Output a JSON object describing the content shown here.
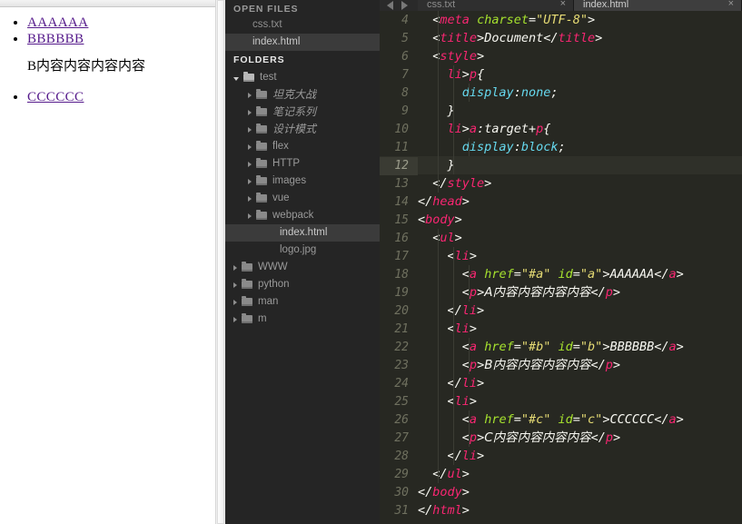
{
  "browser": {
    "links": [
      {
        "label": "AAAAAA",
        "href": "#a"
      },
      {
        "label": "BBBBBB",
        "href": "#b"
      },
      {
        "label": "CCCCCC",
        "href": "#c"
      }
    ],
    "paragraph": "B内容内容内容内容",
    "link_color": "#551a8b"
  },
  "editor": {
    "sidebar": {
      "open_files_label": "OPEN FILES",
      "open_files": [
        {
          "name": "css.txt",
          "selected": false
        },
        {
          "name": "index.html",
          "selected": true
        }
      ],
      "folders_label": "FOLDERS",
      "tree": [
        {
          "name": "test",
          "type": "folder",
          "indent": 0,
          "expanded": true,
          "selected": false
        },
        {
          "name": "坦克大战",
          "type": "folder",
          "indent": 1,
          "expanded": false,
          "selected": false
        },
        {
          "name": "笔记系列",
          "type": "folder",
          "indent": 1,
          "expanded": false,
          "selected": false
        },
        {
          "name": "设计模式",
          "type": "folder",
          "indent": 1,
          "expanded": false,
          "selected": false
        },
        {
          "name": "flex",
          "type": "folder",
          "indent": 1,
          "expanded": false,
          "selected": false
        },
        {
          "name": "HTTP",
          "type": "folder",
          "indent": 1,
          "expanded": false,
          "selected": false
        },
        {
          "name": "images",
          "type": "folder",
          "indent": 1,
          "expanded": false,
          "selected": false
        },
        {
          "name": "vue",
          "type": "folder",
          "indent": 1,
          "expanded": false,
          "selected": false
        },
        {
          "name": "webpack",
          "type": "folder",
          "indent": 1,
          "expanded": false,
          "selected": false
        },
        {
          "name": "index.html",
          "type": "file",
          "indent": 2,
          "expanded": false,
          "selected": true
        },
        {
          "name": "logo.jpg",
          "type": "file",
          "indent": 2,
          "expanded": false,
          "selected": false
        },
        {
          "name": "WWW",
          "type": "folder",
          "indent": 0,
          "expanded": false,
          "selected": false
        },
        {
          "name": "python",
          "type": "folder",
          "indent": 0,
          "expanded": false,
          "selected": false
        },
        {
          "name": "man",
          "type": "folder",
          "indent": 0,
          "expanded": false,
          "selected": false
        },
        {
          "name": "m",
          "type": "folder",
          "indent": 0,
          "expanded": false,
          "selected": false
        }
      ]
    },
    "tabs": [
      {
        "label": "css.txt",
        "active": false,
        "close": "×"
      },
      {
        "label": "index.html",
        "active": true,
        "close": "×"
      }
    ],
    "current_line": 12,
    "first_line": 4,
    "code_lines": [
      {
        "n": 4,
        "guides": 1,
        "tokens": [
          {
            "t": "  ",
            "c": "t-plain"
          },
          {
            "t": "<",
            "c": "t-punct"
          },
          {
            "t": "meta",
            "c": "t-tag"
          },
          {
            "t": " ",
            "c": "t-plain"
          },
          {
            "t": "charset",
            "c": "t-attr"
          },
          {
            "t": "=",
            "c": "t-punct"
          },
          {
            "t": "\"UTF-8\"",
            "c": "t-str"
          },
          {
            "t": ">",
            "c": "t-punct"
          }
        ]
      },
      {
        "n": 5,
        "guides": 1,
        "tokens": [
          {
            "t": "  ",
            "c": "t-plain"
          },
          {
            "t": "<",
            "c": "t-punct"
          },
          {
            "t": "title",
            "c": "t-tag"
          },
          {
            "t": ">",
            "c": "t-punct"
          },
          {
            "t": "Document",
            "c": "t-text"
          },
          {
            "t": "</",
            "c": "t-punct"
          },
          {
            "t": "title",
            "c": "t-tag"
          },
          {
            "t": ">",
            "c": "t-punct"
          }
        ]
      },
      {
        "n": 6,
        "guides": 1,
        "tokens": [
          {
            "t": "  ",
            "c": "t-plain"
          },
          {
            "t": "<",
            "c": "t-punct"
          },
          {
            "t": "style",
            "c": "t-tag"
          },
          {
            "t": ">",
            "c": "t-punct"
          }
        ]
      },
      {
        "n": 7,
        "guides": 2,
        "tokens": [
          {
            "t": "    ",
            "c": "t-plain"
          },
          {
            "t": "li",
            "c": "t-sel"
          },
          {
            "t": ">",
            "c": "t-punct"
          },
          {
            "t": "p",
            "c": "t-sel"
          },
          {
            "t": "{",
            "c": "t-punct"
          }
        ]
      },
      {
        "n": 8,
        "guides": 3,
        "tokens": [
          {
            "t": "      ",
            "c": "t-plain"
          },
          {
            "t": "display",
            "c": "t-prop"
          },
          {
            "t": ":",
            "c": "t-punct"
          },
          {
            "t": "none",
            "c": "t-val"
          },
          {
            "t": ";",
            "c": "t-punct"
          }
        ]
      },
      {
        "n": 9,
        "guides": 2,
        "tokens": [
          {
            "t": "    ",
            "c": "t-plain"
          },
          {
            "t": "}",
            "c": "t-punct"
          }
        ]
      },
      {
        "n": 10,
        "guides": 2,
        "tokens": [
          {
            "t": "    ",
            "c": "t-plain"
          },
          {
            "t": "li",
            "c": "t-sel"
          },
          {
            "t": ">",
            "c": "t-punct"
          },
          {
            "t": "a",
            "c": "t-sel"
          },
          {
            "t": ":",
            "c": "t-punct"
          },
          {
            "t": "target",
            "c": "t-text"
          },
          {
            "t": "+",
            "c": "t-punct"
          },
          {
            "t": "p",
            "c": "t-sel"
          },
          {
            "t": "{",
            "c": "t-punct"
          }
        ]
      },
      {
        "n": 11,
        "guides": 3,
        "tokens": [
          {
            "t": "      ",
            "c": "t-plain"
          },
          {
            "t": "display",
            "c": "t-prop"
          },
          {
            "t": ":",
            "c": "t-punct"
          },
          {
            "t": "block",
            "c": "t-val"
          },
          {
            "t": ";",
            "c": "t-punct"
          }
        ]
      },
      {
        "n": 12,
        "guides": 2,
        "tokens": [
          {
            "t": "    ",
            "c": "t-plain"
          },
          {
            "t": "}",
            "c": "t-punct"
          }
        ]
      },
      {
        "n": 13,
        "guides": 1,
        "tokens": [
          {
            "t": "  ",
            "c": "t-plain"
          },
          {
            "t": "</",
            "c": "t-punct"
          },
          {
            "t": "style",
            "c": "t-tag"
          },
          {
            "t": ">",
            "c": "t-punct"
          }
        ]
      },
      {
        "n": 14,
        "guides": 0,
        "tokens": [
          {
            "t": "</",
            "c": "t-punct"
          },
          {
            "t": "head",
            "c": "t-tag"
          },
          {
            "t": ">",
            "c": "t-punct"
          }
        ]
      },
      {
        "n": 15,
        "guides": 0,
        "tokens": [
          {
            "t": "<",
            "c": "t-punct"
          },
          {
            "t": "body",
            "c": "t-tag"
          },
          {
            "t": ">",
            "c": "t-punct"
          }
        ]
      },
      {
        "n": 16,
        "guides": 1,
        "tokens": [
          {
            "t": "  ",
            "c": "t-plain"
          },
          {
            "t": "<",
            "c": "t-punct"
          },
          {
            "t": "ul",
            "c": "t-tag"
          },
          {
            "t": ">",
            "c": "t-punct"
          }
        ]
      },
      {
        "n": 17,
        "guides": 2,
        "tokens": [
          {
            "t": "    ",
            "c": "t-plain"
          },
          {
            "t": "<",
            "c": "t-punct"
          },
          {
            "t": "li",
            "c": "t-tag"
          },
          {
            "t": ">",
            "c": "t-punct"
          }
        ]
      },
      {
        "n": 18,
        "guides": 3,
        "tokens": [
          {
            "t": "      ",
            "c": "t-plain"
          },
          {
            "t": "<",
            "c": "t-punct"
          },
          {
            "t": "a",
            "c": "t-tag"
          },
          {
            "t": " ",
            "c": "t-plain"
          },
          {
            "t": "href",
            "c": "t-attr"
          },
          {
            "t": "=",
            "c": "t-punct"
          },
          {
            "t": "\"#a\"",
            "c": "t-str"
          },
          {
            "t": " ",
            "c": "t-plain"
          },
          {
            "t": "id",
            "c": "t-attr"
          },
          {
            "t": "=",
            "c": "t-punct"
          },
          {
            "t": "\"a\"",
            "c": "t-str"
          },
          {
            "t": ">",
            "c": "t-punct"
          },
          {
            "t": "AAAAAA",
            "c": "t-text"
          },
          {
            "t": "</",
            "c": "t-punct"
          },
          {
            "t": "a",
            "c": "t-tag"
          },
          {
            "t": ">",
            "c": "t-punct"
          }
        ]
      },
      {
        "n": 19,
        "guides": 3,
        "tokens": [
          {
            "t": "      ",
            "c": "t-plain"
          },
          {
            "t": "<",
            "c": "t-punct"
          },
          {
            "t": "p",
            "c": "t-tag"
          },
          {
            "t": ">",
            "c": "t-punct"
          },
          {
            "t": "A内容内容内容内容",
            "c": "t-text"
          },
          {
            "t": "</",
            "c": "t-punct"
          },
          {
            "t": "p",
            "c": "t-tag"
          },
          {
            "t": ">",
            "c": "t-punct"
          }
        ]
      },
      {
        "n": 20,
        "guides": 2,
        "tokens": [
          {
            "t": "    ",
            "c": "t-plain"
          },
          {
            "t": "</",
            "c": "t-punct"
          },
          {
            "t": "li",
            "c": "t-tag"
          },
          {
            "t": ">",
            "c": "t-punct"
          }
        ]
      },
      {
        "n": 21,
        "guides": 2,
        "tokens": [
          {
            "t": "    ",
            "c": "t-plain"
          },
          {
            "t": "<",
            "c": "t-punct"
          },
          {
            "t": "li",
            "c": "t-tag"
          },
          {
            "t": ">",
            "c": "t-punct"
          }
        ]
      },
      {
        "n": 22,
        "guides": 3,
        "tokens": [
          {
            "t": "      ",
            "c": "t-plain"
          },
          {
            "t": "<",
            "c": "t-punct"
          },
          {
            "t": "a",
            "c": "t-tag"
          },
          {
            "t": " ",
            "c": "t-plain"
          },
          {
            "t": "href",
            "c": "t-attr"
          },
          {
            "t": "=",
            "c": "t-punct"
          },
          {
            "t": "\"#b\"",
            "c": "t-str"
          },
          {
            "t": " ",
            "c": "t-plain"
          },
          {
            "t": "id",
            "c": "t-attr"
          },
          {
            "t": "=",
            "c": "t-punct"
          },
          {
            "t": "\"b\"",
            "c": "t-str"
          },
          {
            "t": ">",
            "c": "t-punct"
          },
          {
            "t": "BBBBBB",
            "c": "t-text"
          },
          {
            "t": "</",
            "c": "t-punct"
          },
          {
            "t": "a",
            "c": "t-tag"
          },
          {
            "t": ">",
            "c": "t-punct"
          }
        ]
      },
      {
        "n": 23,
        "guides": 3,
        "tokens": [
          {
            "t": "      ",
            "c": "t-plain"
          },
          {
            "t": "<",
            "c": "t-punct"
          },
          {
            "t": "p",
            "c": "t-tag"
          },
          {
            "t": ">",
            "c": "t-punct"
          },
          {
            "t": "B内容内容内容内容",
            "c": "t-text"
          },
          {
            "t": "</",
            "c": "t-punct"
          },
          {
            "t": "p",
            "c": "t-tag"
          },
          {
            "t": ">",
            "c": "t-punct"
          }
        ]
      },
      {
        "n": 24,
        "guides": 2,
        "tokens": [
          {
            "t": "    ",
            "c": "t-plain"
          },
          {
            "t": "</",
            "c": "t-punct"
          },
          {
            "t": "li",
            "c": "t-tag"
          },
          {
            "t": ">",
            "c": "t-punct"
          }
        ]
      },
      {
        "n": 25,
        "guides": 2,
        "tokens": [
          {
            "t": "    ",
            "c": "t-plain"
          },
          {
            "t": "<",
            "c": "t-punct"
          },
          {
            "t": "li",
            "c": "t-tag"
          },
          {
            "t": ">",
            "c": "t-punct"
          }
        ]
      },
      {
        "n": 26,
        "guides": 3,
        "tokens": [
          {
            "t": "      ",
            "c": "t-plain"
          },
          {
            "t": "<",
            "c": "t-punct"
          },
          {
            "t": "a",
            "c": "t-tag"
          },
          {
            "t": " ",
            "c": "t-plain"
          },
          {
            "t": "href",
            "c": "t-attr"
          },
          {
            "t": "=",
            "c": "t-punct"
          },
          {
            "t": "\"#c\"",
            "c": "t-str"
          },
          {
            "t": " ",
            "c": "t-plain"
          },
          {
            "t": "id",
            "c": "t-attr"
          },
          {
            "t": "=",
            "c": "t-punct"
          },
          {
            "t": "\"c\"",
            "c": "t-str"
          },
          {
            "t": ">",
            "c": "t-punct"
          },
          {
            "t": "CCCCCC",
            "c": "t-text"
          },
          {
            "t": "</",
            "c": "t-punct"
          },
          {
            "t": "a",
            "c": "t-tag"
          },
          {
            "t": ">",
            "c": "t-punct"
          }
        ]
      },
      {
        "n": 27,
        "guides": 3,
        "tokens": [
          {
            "t": "      ",
            "c": "t-plain"
          },
          {
            "t": "<",
            "c": "t-punct"
          },
          {
            "t": "p",
            "c": "t-tag"
          },
          {
            "t": ">",
            "c": "t-punct"
          },
          {
            "t": "C内容内容内容内容",
            "c": "t-text"
          },
          {
            "t": "</",
            "c": "t-punct"
          },
          {
            "t": "p",
            "c": "t-tag"
          },
          {
            "t": ">",
            "c": "t-punct"
          }
        ]
      },
      {
        "n": 28,
        "guides": 2,
        "tokens": [
          {
            "t": "    ",
            "c": "t-plain"
          },
          {
            "t": "</",
            "c": "t-punct"
          },
          {
            "t": "li",
            "c": "t-tag"
          },
          {
            "t": ">",
            "c": "t-punct"
          }
        ]
      },
      {
        "n": 29,
        "guides": 1,
        "tokens": [
          {
            "t": "  ",
            "c": "t-plain"
          },
          {
            "t": "</",
            "c": "t-punct"
          },
          {
            "t": "ul",
            "c": "t-tag"
          },
          {
            "t": ">",
            "c": "t-punct"
          }
        ]
      },
      {
        "n": 30,
        "guides": 0,
        "tokens": [
          {
            "t": "</",
            "c": "t-punct"
          },
          {
            "t": "body",
            "c": "t-tag"
          },
          {
            "t": ">",
            "c": "t-punct"
          }
        ]
      },
      {
        "n": 31,
        "guides": 0,
        "tokens": [
          {
            "t": "</",
            "c": "t-punct"
          },
          {
            "t": "html",
            "c": "t-tag"
          },
          {
            "t": ">",
            "c": "t-punct"
          }
        ]
      }
    ]
  },
  "theme": {
    "editor_bg": "#272822",
    "sidebar_bg": "#252525",
    "tag_color": "#f92672",
    "attr_color": "#a6e22e",
    "string_color": "#e6db74",
    "property_color": "#66d9ef",
    "text_color": "#f8f8f2",
    "gutter_color": "#6f705f"
  }
}
